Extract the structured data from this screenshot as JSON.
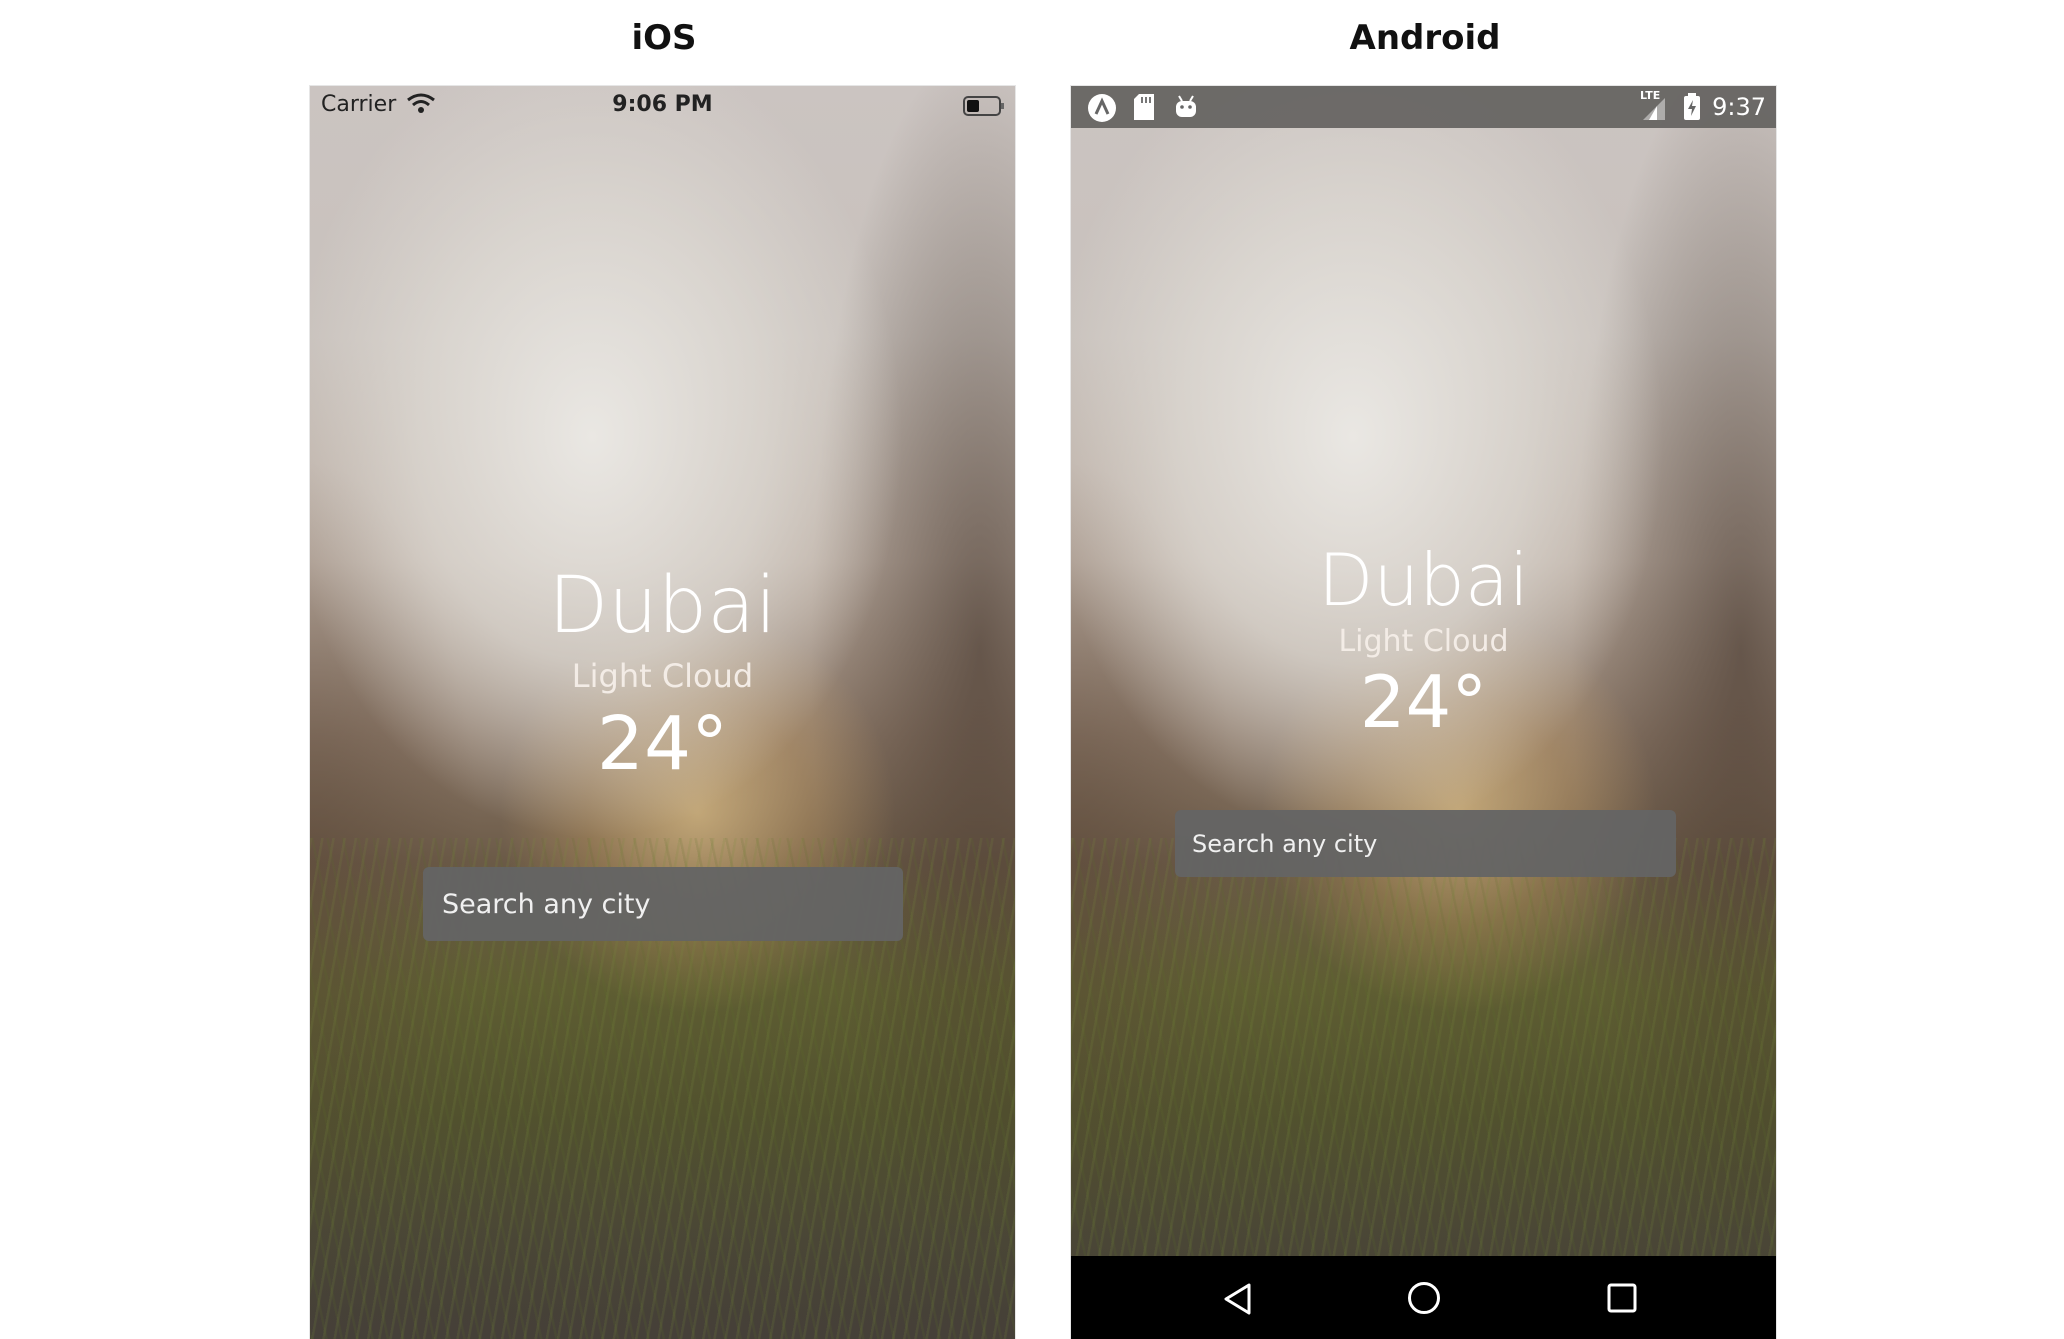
{
  "ios": {
    "heading": "iOS",
    "status": {
      "carrier": "Carrier",
      "time": "9:06 PM"
    },
    "weather": {
      "city": "Dubai",
      "condition": "Light Cloud",
      "temperature": "24°"
    },
    "search": {
      "placeholder": "Search any city"
    }
  },
  "android": {
    "heading": "Android",
    "status": {
      "time": "9:37",
      "network": "LTE"
    },
    "weather": {
      "city": "Dubai",
      "condition": "Light Cloud",
      "temperature": "24°"
    },
    "search": {
      "placeholder": "Search any city"
    }
  }
}
